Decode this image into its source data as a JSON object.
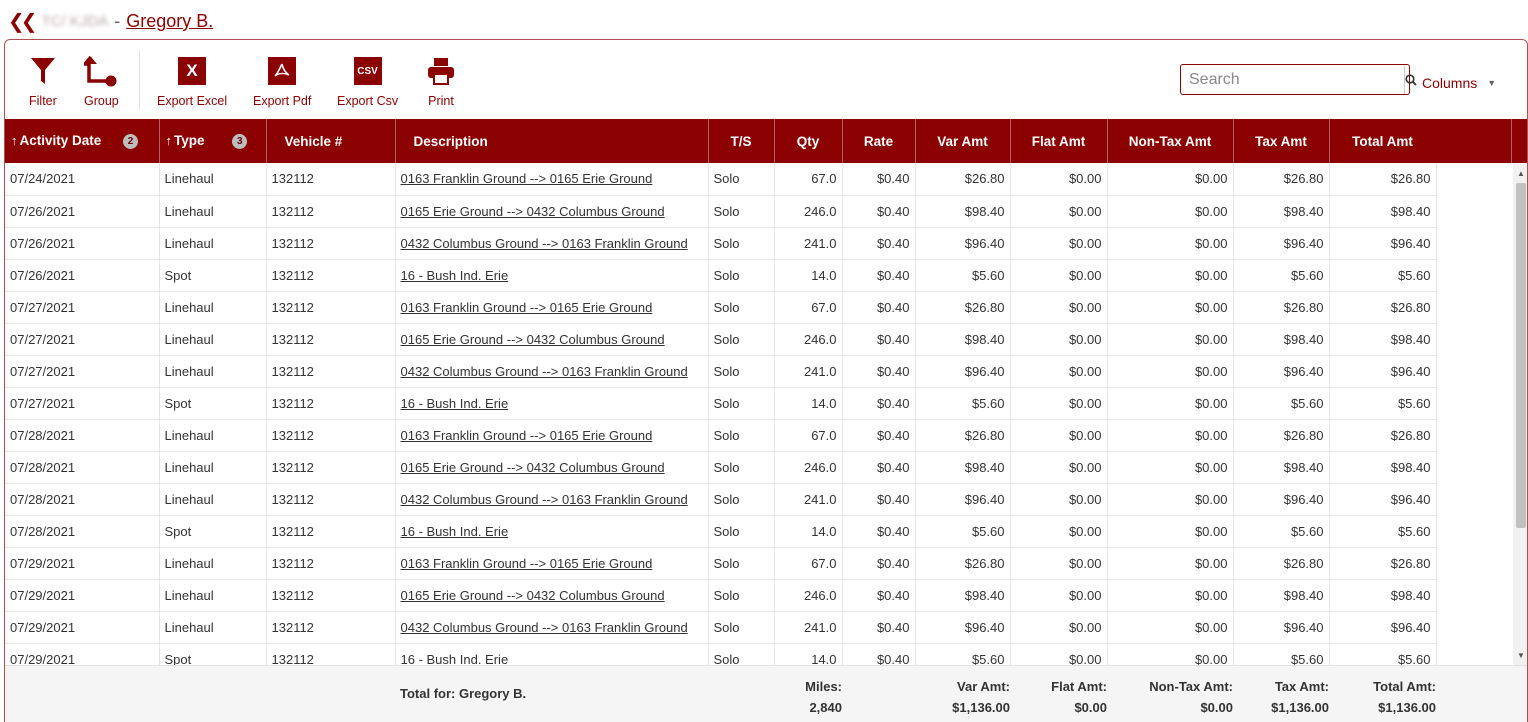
{
  "breadcrumb": {
    "back_icon": "double-chevron-left-icon",
    "parent": "TC/ KJDA",
    "separator": "-",
    "current": "Gregory B."
  },
  "toolbar": {
    "filter": "Filter",
    "group": "Group",
    "export_excel": "Export Excel",
    "export_pdf": "Export Pdf",
    "export_csv": "Export Csv",
    "print": "Print",
    "csv_tile": "CSV",
    "excel_tile": "X"
  },
  "search": {
    "placeholder": "Search",
    "value": ""
  },
  "columns_label": "Columns",
  "colors": {
    "accent": "#8b0000"
  },
  "table": {
    "headers": {
      "activity_date": "Activity Date",
      "activity_date_sort": "2",
      "type": "Type",
      "type_sort": "3",
      "vehicle": "Vehicle #",
      "description": "Description",
      "ts": "T/S",
      "qty": "Qty",
      "rate": "Rate",
      "var_amt": "Var Amt",
      "flat_amt": "Flat Amt",
      "nontax_amt": "Non-Tax Amt",
      "tax_amt": "Tax Amt",
      "total_amt": "Total Amt"
    },
    "rows": [
      {
        "date": "07/24/2021",
        "type": "Linehaul",
        "vehicle": "132112",
        "desc": "0163 Franklin Ground --> 0165 Erie Ground",
        "ts": "Solo",
        "qty": "67.0",
        "rate": "$0.40",
        "var": "$26.80",
        "flat": "$0.00",
        "nontax": "$0.00",
        "tax": "$26.80",
        "total": "$26.80"
      },
      {
        "date": "07/26/2021",
        "type": "Linehaul",
        "vehicle": "132112",
        "desc": "0165 Erie Ground --> 0432 Columbus Ground",
        "ts": "Solo",
        "qty": "246.0",
        "rate": "$0.40",
        "var": "$98.40",
        "flat": "$0.00",
        "nontax": "$0.00",
        "tax": "$98.40",
        "total": "$98.40"
      },
      {
        "date": "07/26/2021",
        "type": "Linehaul",
        "vehicle": "132112",
        "desc": "0432 Columbus Ground --> 0163 Franklin Ground",
        "ts": "Solo",
        "qty": "241.0",
        "rate": "$0.40",
        "var": "$96.40",
        "flat": "$0.00",
        "nontax": "$0.00",
        "tax": "$96.40",
        "total": "$96.40"
      },
      {
        "date": "07/26/2021",
        "type": "Spot",
        "vehicle": "132112",
        "desc": "16 - Bush Ind. Erie",
        "ts": "Solo",
        "qty": "14.0",
        "rate": "$0.40",
        "var": "$5.60",
        "flat": "$0.00",
        "nontax": "$0.00",
        "tax": "$5.60",
        "total": "$5.60"
      },
      {
        "date": "07/27/2021",
        "type": "Linehaul",
        "vehicle": "132112",
        "desc": "0163 Franklin Ground --> 0165 Erie Ground",
        "ts": "Solo",
        "qty": "67.0",
        "rate": "$0.40",
        "var": "$26.80",
        "flat": "$0.00",
        "nontax": "$0.00",
        "tax": "$26.80",
        "total": "$26.80"
      },
      {
        "date": "07/27/2021",
        "type": "Linehaul",
        "vehicle": "132112",
        "desc": "0165 Erie Ground --> 0432 Columbus Ground",
        "ts": "Solo",
        "qty": "246.0",
        "rate": "$0.40",
        "var": "$98.40",
        "flat": "$0.00",
        "nontax": "$0.00",
        "tax": "$98.40",
        "total": "$98.40"
      },
      {
        "date": "07/27/2021",
        "type": "Linehaul",
        "vehicle": "132112",
        "desc": "0432 Columbus Ground --> 0163 Franklin Ground",
        "ts": "Solo",
        "qty": "241.0",
        "rate": "$0.40",
        "var": "$96.40",
        "flat": "$0.00",
        "nontax": "$0.00",
        "tax": "$96.40",
        "total": "$96.40"
      },
      {
        "date": "07/27/2021",
        "type": "Spot",
        "vehicle": "132112",
        "desc": "16 - Bush Ind. Erie",
        "ts": "Solo",
        "qty": "14.0",
        "rate": "$0.40",
        "var": "$5.60",
        "flat": "$0.00",
        "nontax": "$0.00",
        "tax": "$5.60",
        "total": "$5.60"
      },
      {
        "date": "07/28/2021",
        "type": "Linehaul",
        "vehicle": "132112",
        "desc": "0163 Franklin Ground --> 0165 Erie Ground",
        "ts": "Solo",
        "qty": "67.0",
        "rate": "$0.40",
        "var": "$26.80",
        "flat": "$0.00",
        "nontax": "$0.00",
        "tax": "$26.80",
        "total": "$26.80"
      },
      {
        "date": "07/28/2021",
        "type": "Linehaul",
        "vehicle": "132112",
        "desc": "0165 Erie Ground --> 0432 Columbus Ground",
        "ts": "Solo",
        "qty": "246.0",
        "rate": "$0.40",
        "var": "$98.40",
        "flat": "$0.00",
        "nontax": "$0.00",
        "tax": "$98.40",
        "total": "$98.40"
      },
      {
        "date": "07/28/2021",
        "type": "Linehaul",
        "vehicle": "132112",
        "desc": "0432 Columbus Ground --> 0163 Franklin Ground",
        "ts": "Solo",
        "qty": "241.0",
        "rate": "$0.40",
        "var": "$96.40",
        "flat": "$0.00",
        "nontax": "$0.00",
        "tax": "$96.40",
        "total": "$96.40"
      },
      {
        "date": "07/28/2021",
        "type": "Spot",
        "vehicle": "132112",
        "desc": "16 - Bush Ind. Erie",
        "ts": "Solo",
        "qty": "14.0",
        "rate": "$0.40",
        "var": "$5.60",
        "flat": "$0.00",
        "nontax": "$0.00",
        "tax": "$5.60",
        "total": "$5.60"
      },
      {
        "date": "07/29/2021",
        "type": "Linehaul",
        "vehicle": "132112",
        "desc": "0163 Franklin Ground --> 0165 Erie Ground",
        "ts": "Solo",
        "qty": "67.0",
        "rate": "$0.40",
        "var": "$26.80",
        "flat": "$0.00",
        "nontax": "$0.00",
        "tax": "$26.80",
        "total": "$26.80"
      },
      {
        "date": "07/29/2021",
        "type": "Linehaul",
        "vehicle": "132112",
        "desc": "0165 Erie Ground --> 0432 Columbus Ground",
        "ts": "Solo",
        "qty": "246.0",
        "rate": "$0.40",
        "var": "$98.40",
        "flat": "$0.00",
        "nontax": "$0.00",
        "tax": "$98.40",
        "total": "$98.40"
      },
      {
        "date": "07/29/2021",
        "type": "Linehaul",
        "vehicle": "132112",
        "desc": "0432 Columbus Ground --> 0163 Franklin Ground",
        "ts": "Solo",
        "qty": "241.0",
        "rate": "$0.40",
        "var": "$96.40",
        "flat": "$0.00",
        "nontax": "$0.00",
        "tax": "$96.40",
        "total": "$96.40"
      },
      {
        "date": "07/29/2021",
        "type": "Spot",
        "vehicle": "132112",
        "desc": "16 - Bush Ind. Erie",
        "ts": "Solo",
        "qty": "14.0",
        "rate": "$0.40",
        "var": "$5.60",
        "flat": "$0.00",
        "nontax": "$0.00",
        "tax": "$5.60",
        "total": "$5.60"
      }
    ]
  },
  "footer": {
    "total_label": "Total for: Gregory B.",
    "miles_label": "Miles:",
    "miles_value": "2,840",
    "var_label": "Var Amt:",
    "var_value": "$1,136.00",
    "flat_label": "Flat Amt:",
    "flat_value": "$0.00",
    "nontax_label": "Non-Tax Amt:",
    "nontax_value": "$0.00",
    "tax_label": "Tax Amt:",
    "tax_value": "$1,136.00",
    "total_amt_label": "Total Amt:",
    "total_amt_value": "$1,136.00"
  }
}
